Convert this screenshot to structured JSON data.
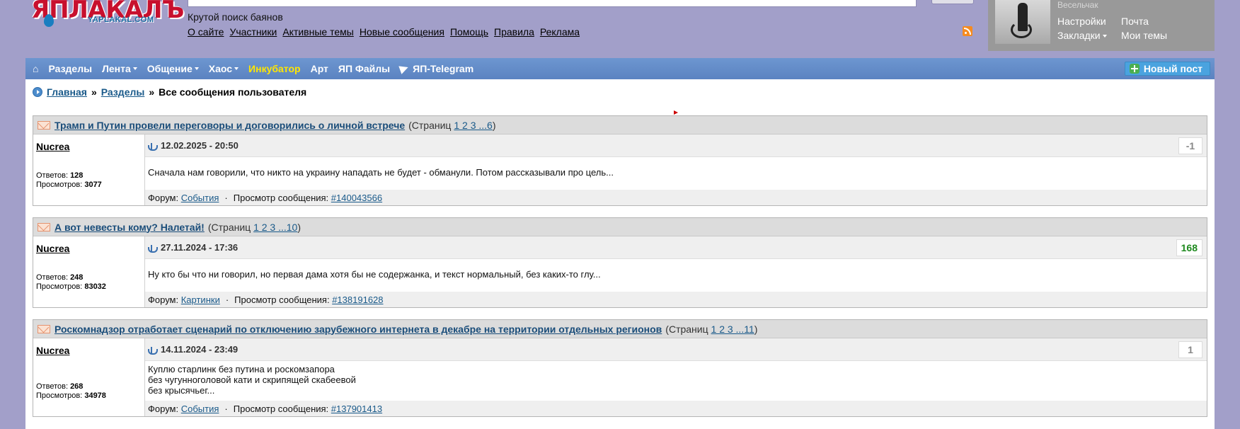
{
  "header": {
    "logo_main": "ЯПЛАКАЛЪ",
    "logo_sub": "YAPLAKAL.COM",
    "tagline": "Крутой поиск баянов",
    "links": [
      "О сайте",
      "Участники",
      "Активные темы",
      "Новые сообщения",
      "Помощь",
      "Правила",
      "Реклама"
    ],
    "user": {
      "rank": "Весельчак",
      "links": [
        "Настройки",
        "Почта",
        "Закладки",
        "Мои темы"
      ]
    }
  },
  "nav": {
    "items": [
      "Разделы",
      "Лента",
      "Общение",
      "Хаос",
      "Инкубатор",
      "Арт",
      "ЯП Файлы",
      "ЯП-Telegram"
    ],
    "new_post": "Новый пост",
    "colors": {
      "bar": "#5b83c1",
      "highlight": "#ffe600"
    }
  },
  "breadcrumb": {
    "home": "Главная",
    "sep1": "»",
    "sections": "Разделы",
    "sep2": "»",
    "current": "Все сообщения пользователя"
  },
  "topics": [
    {
      "title": "Трамп и Путин провели переговоры и договорились о личной встрече",
      "pages_prefix": "(Страниц",
      "pages": "1 2 3 ...6",
      "pages_suffix": ")",
      "author": "Nucrea",
      "replies_label": "Ответов:",
      "replies": "128",
      "views_label": "Просмотров:",
      "views": "3077",
      "date": "12.02.2025 - 20:50",
      "rating": "-1",
      "text": "Сначала нам говорили, что никто на украину нападать не будет - обманули. Потом рассказывали про цель...",
      "forum_label": "Форум:",
      "forum": "События",
      "view_label": "Просмотр сообщения:",
      "post_id": "#140043566"
    },
    {
      "title": "А вот невесты кому? Налетай!",
      "pages_prefix": "(Страниц",
      "pages": "1 2 3 ...10",
      "pages_suffix": ")",
      "author": "Nucrea",
      "replies_label": "Ответов:",
      "replies": "248",
      "views_label": "Просмотров:",
      "views": "83032",
      "date": "27.11.2024 - 17:36",
      "rating": "168",
      "text": "Ну кто бы что ни говорил, но первая дама хотя бы не содержанка, и текст нормальный, без каких-то глу...",
      "forum_label": "Форум:",
      "forum": "Картинки",
      "view_label": "Просмотр сообщения:",
      "post_id": "#138191628"
    },
    {
      "title": "Роскомнадзор отработает сценарий по отключению зарубежного интернета в декабре на территории отдельных регионов",
      "pages_prefix": "(Страниц",
      "pages": "1 2 3 ...11",
      "pages_suffix": ")",
      "author": "Nucrea",
      "replies_label": "Ответов:",
      "replies": "268",
      "views_label": "Просмотров:",
      "views": "34978",
      "date": "14.11.2024 - 23:49",
      "rating": "1",
      "text_lines": [
        "Куплю старлинк без путина и роскомзапора",
        "без чугунноголовой кати и скрипящей скабеевой",
        "без крысячьег..."
      ],
      "forum_label": "Форум:",
      "forum": "События",
      "view_label": "Просмотр сообщения:",
      "post_id": "#137901413"
    }
  ]
}
